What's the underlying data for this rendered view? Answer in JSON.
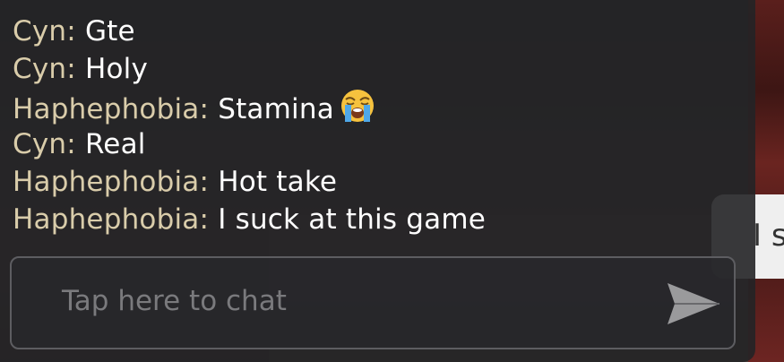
{
  "chat": {
    "messages": [
      {
        "name": "Cyn:",
        "text": "Gte"
      },
      {
        "name": "Cyn:",
        "text": "Holy"
      },
      {
        "name": "Haphephobia:",
        "text": "Stamina",
        "emoji": "loudly-crying-face-icon"
      },
      {
        "name": "Cyn:",
        "text": "Real"
      },
      {
        "name": "Haphephobia:",
        "text": "Hot take"
      },
      {
        "name": "Haphephobia:",
        "text": "I suck at this game"
      }
    ],
    "input": {
      "placeholder": "Tap here to chat",
      "send_icon": "send-arrow-icon"
    }
  },
  "speech_bubble": {
    "text": "I s"
  },
  "colors": {
    "name_color": "#d9ccaa",
    "message_color": "#ffffff",
    "placeholder_color": "#7a7a7d",
    "panel_bg": "#242426"
  }
}
